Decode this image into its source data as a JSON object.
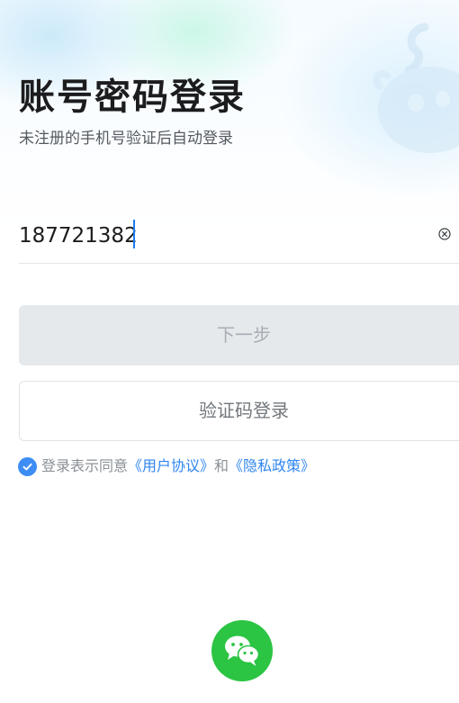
{
  "header": {
    "title": "账号密码登录",
    "subtitle": "未注册的手机号验证后自动登录"
  },
  "account": {
    "value": "187721382",
    "clear_icon": "clear-circle-icon"
  },
  "buttons": {
    "next_label": "下一步",
    "sms_login_label": "验证码登录"
  },
  "agreement": {
    "checked": true,
    "prefix": "登录表示同意",
    "user_agreement": "《用户协议》",
    "conjunction": "和",
    "privacy_policy": "《隐私政策》"
  },
  "social": {
    "wechat_icon": "wechat-icon"
  },
  "colors": {
    "accent": "#2f86f0",
    "wechat_green": "#2bc443",
    "disabled_button": "#e6e9ec"
  }
}
